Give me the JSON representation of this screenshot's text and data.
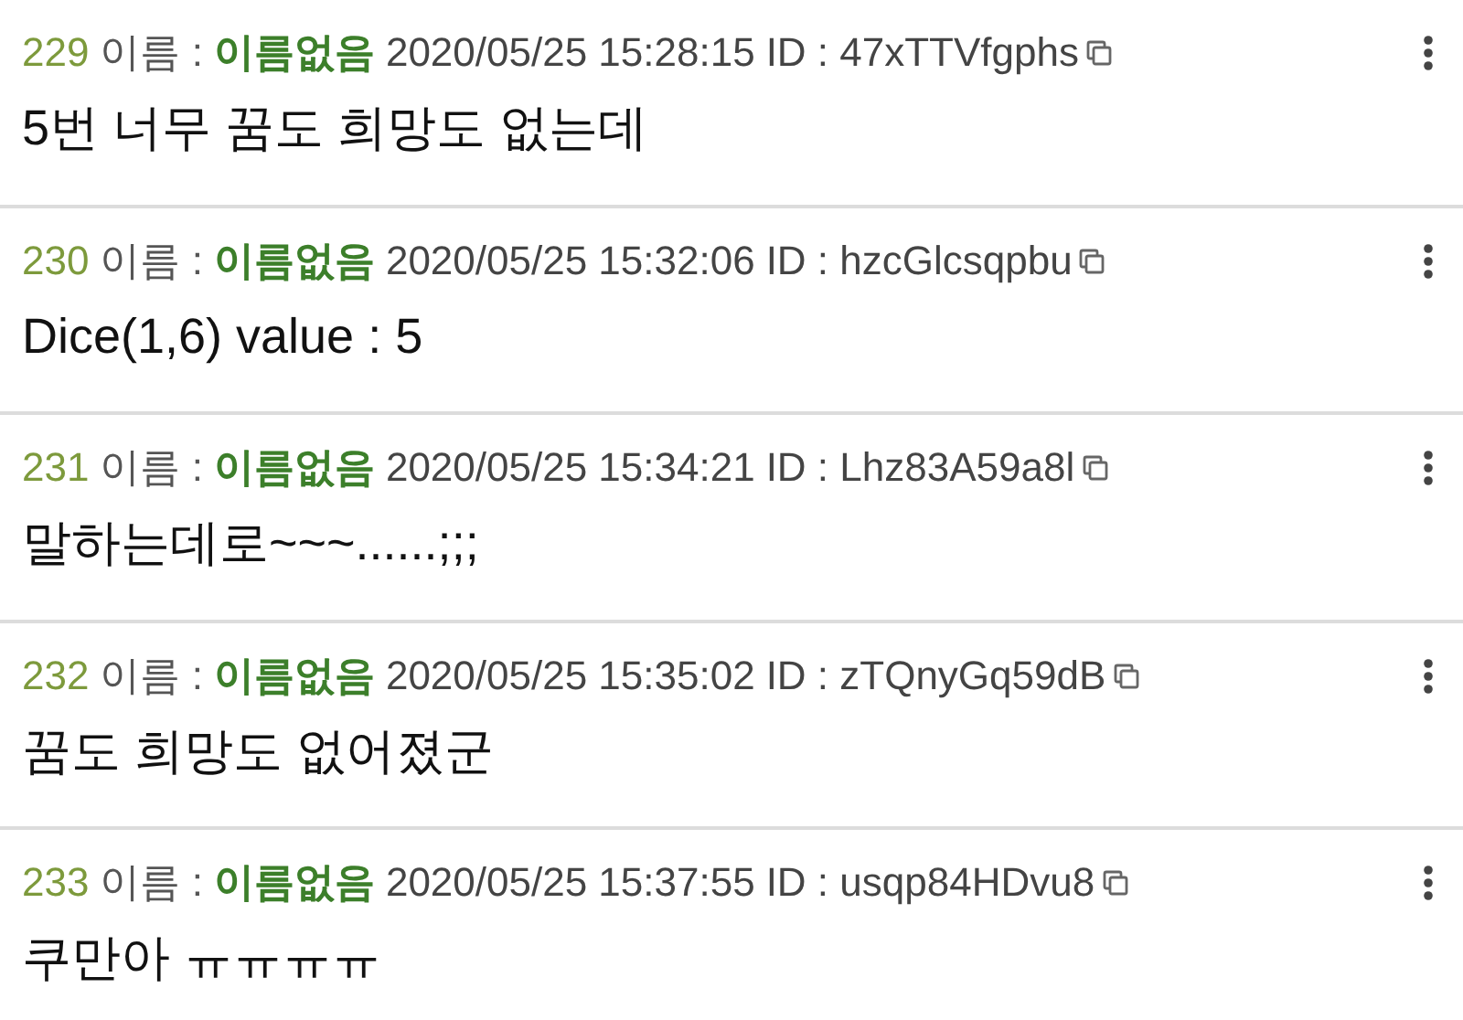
{
  "posts": [
    {
      "number": "229",
      "name_label": "이름 :",
      "author": "이름없음",
      "timestamp": "2020/05/25 15:28:15",
      "id": "ID : 47xTTVfgphs",
      "body": "5번 너무 꿈도 희망도 없는데"
    },
    {
      "number": "230",
      "name_label": "이름 :",
      "author": "이름없음",
      "timestamp": "2020/05/25 15:32:06",
      "id": "ID : hzcGlcsqpbu",
      "body": "Dice(1,6) value : 5"
    },
    {
      "number": "231",
      "name_label": "이름 :",
      "author": "이름없음",
      "timestamp": "2020/05/25 15:34:21",
      "id": "ID : Lhz83A59a8l",
      "body": "말하는데로~~~......;;;"
    },
    {
      "number": "232",
      "name_label": "이름 :",
      "author": "이름없음",
      "timestamp": "2020/05/25 15:35:02",
      "id": "ID : zTQnyGq59dB",
      "body": "꿈도 희망도 없어졌군"
    },
    {
      "number": "233",
      "name_label": "이름 :",
      "author": "이름없음",
      "timestamp": "2020/05/25 15:37:55",
      "id": "ID : usqp84HDvu8",
      "body": "쿠만아 ㅠㅠㅠㅠ"
    }
  ]
}
